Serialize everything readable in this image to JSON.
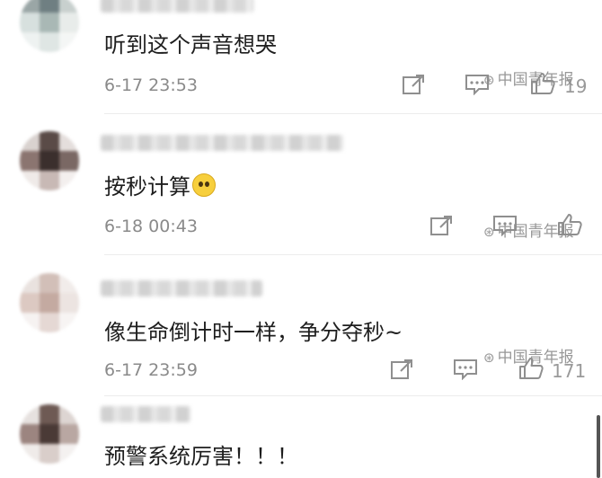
{
  "comments": [
    {
      "text": "听到这个声音想哭",
      "time": "6-17 23:53",
      "likes": "19"
    },
    {
      "text": "按秒计算",
      "time": "6-18 00:43",
      "likes": ""
    },
    {
      "text": "像生命倒计时一样，争分夺秒~",
      "time": "6-17 23:59",
      "likes": "171"
    },
    {
      "text": "预警系统厉害！！！",
      "time": "",
      "likes": ""
    }
  ],
  "watermark": "中国青年报",
  "colors": {
    "text": "#1e1e1e",
    "meta": "#8a8a8a",
    "icon": "#8f8f8f"
  },
  "icons": [
    "share-icon",
    "reply-icon",
    "like-icon",
    "emoji-icon"
  ]
}
